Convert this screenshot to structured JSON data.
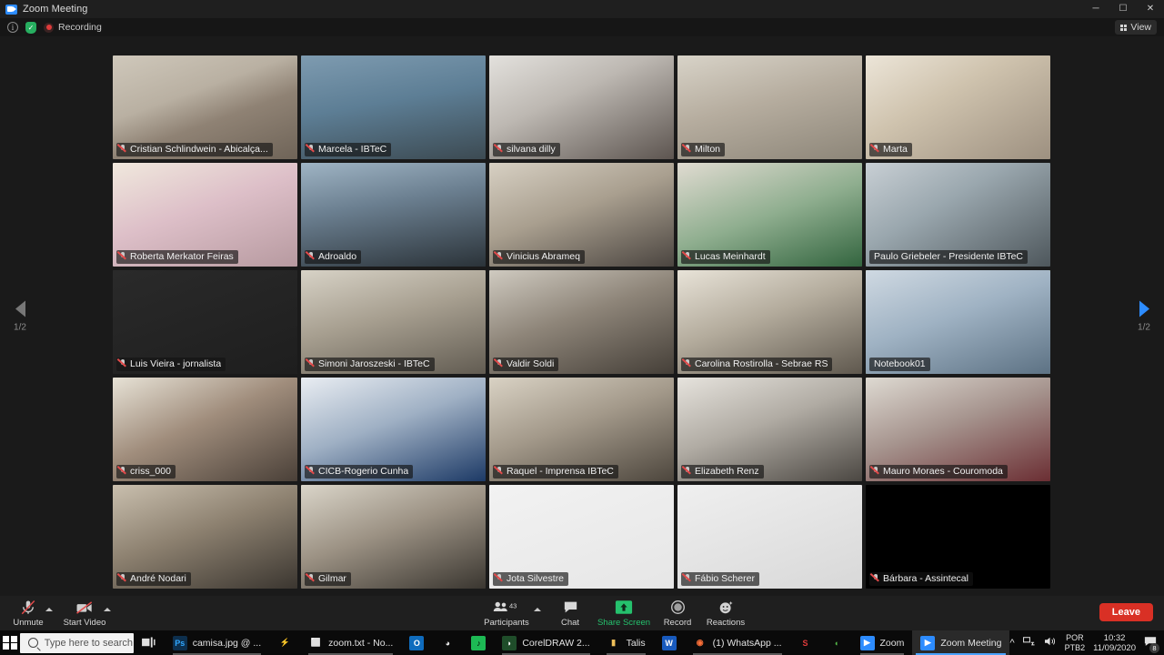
{
  "window": {
    "title": "Zoom Meeting",
    "logo_icon": "zoom-logo-icon",
    "minimize_label": "─",
    "maximize_label": "☐",
    "close_label": "✕"
  },
  "meeting_header": {
    "info_icon": "info-icon",
    "info_label": "i",
    "encryption_icon": "shield-check-icon",
    "encryption_label": "✓",
    "recording_icon": "recording-dot-icon",
    "recording_label": "Recording",
    "view_label": "View",
    "view_icon": "grid-view-icon"
  },
  "gallery": {
    "page_left_icon": "chevron-left-icon",
    "page_right_icon": "chevron-right-icon",
    "page_indicator_left": "1/2",
    "page_indicator_right": "1/2",
    "active_border_color": "#d6e040",
    "participants": [
      {
        "name": "Cristian Schlindwein - Abicalça...",
        "muted": true,
        "active": false,
        "bg": "linear-gradient(160deg,#cfc8bb 0%,#b9b0a2 38%,#8f8274 60%,#6f6458 100%)"
      },
      {
        "name": "Marcela - IBTeC",
        "muted": true,
        "active": false,
        "bg": "linear-gradient(170deg,#7e9bb0 0%,#5d7e95 45%,#3c4a52 100%)"
      },
      {
        "name": "silvana dilly",
        "muted": true,
        "active": false,
        "bg": "linear-gradient(155deg,#e3e1dd 0%,#bdb8b2 40%,#5d5550 100%)"
      },
      {
        "name": "Milton",
        "muted": true,
        "active": false,
        "bg": "linear-gradient(165deg,#d8d3c8 0%,#b6ad9f 45%,#8d8679 100%)"
      },
      {
        "name": "Marta",
        "muted": true,
        "active": false,
        "bg": "linear-gradient(150deg,#ece5d8 0%,#cfc3ae 40%,#9d9080 100%)"
      },
      {
        "name": "Roberta Merkator Feiras",
        "muted": true,
        "active": false,
        "bg": "linear-gradient(160deg,#f0e8dd 0%,#ddbfc8 45%,#b79aa0 100%)"
      },
      {
        "name": "Adroaldo",
        "muted": true,
        "active": false,
        "bg": "linear-gradient(170deg,#9fb4c4 0%,#6b7f90 40%,#2b3339 100%)"
      },
      {
        "name": "Vinicius Abrameq",
        "muted": true,
        "active": false,
        "bg": "linear-gradient(160deg,#d7d0c3 0%,#a99f8f 45%,#4b4540 100%)"
      },
      {
        "name": "Lucas Meinhardt",
        "muted": true,
        "active": false,
        "bg": "linear-gradient(160deg,#e0dbd1 0%,#8fae8f 50%,#33653f 100%)"
      },
      {
        "name": "Paulo Griebeler - Presidente IBTeC",
        "muted": false,
        "active": false,
        "bg": "linear-gradient(150deg,#c8cfd4 0%,#9aa7ae 40%,#4e575c 100%)"
      },
      {
        "name": "Luis Vieira - jornalista",
        "muted": true,
        "active": false,
        "bg": "linear-gradient(160deg,#2a2a2a 0%,#1e1e1e 100%)"
      },
      {
        "name": "Simoni Jaroszeski - IBTeC",
        "muted": true,
        "active": false,
        "bg": "linear-gradient(165deg,#d7d2c6 0%,#a79f90 45%,#625c52 100%)"
      },
      {
        "name": "Valdir Soldi",
        "muted": true,
        "active": false,
        "bg": "linear-gradient(160deg,#cfcac0 0%,#8e8579 45%,#453f38 100%)"
      },
      {
        "name": "Carolina Rostirolla - Sebrae RS",
        "muted": true,
        "active": false,
        "bg": "linear-gradient(160deg,#e8e3d8 0%,#b3ab9c 45%,#5f584e 100%)"
      },
      {
        "name": "Notebook01",
        "muted": false,
        "active": true,
        "bg": "linear-gradient(160deg,#cfd9e2 0%,#9fb2c3 45%,#5d7284 100%)"
      },
      {
        "name": "criss_000",
        "muted": true,
        "active": false,
        "bg": "linear-gradient(155deg,#e7e2d6 0%,#a08d7c 45%,#4a4038 100%)"
      },
      {
        "name": "CICB-Rogerio Cunha",
        "muted": true,
        "active": false,
        "bg": "linear-gradient(160deg,#e9edf2 0%,#9fb0c4 45%,#1d3a66 100%)"
      },
      {
        "name": "Raquel - Imprensa IBTeC",
        "muted": true,
        "active": false,
        "bg": "linear-gradient(160deg,#d9d2c4 0%,#a3998a 45%,#4d463d 100%)"
      },
      {
        "name": "Elizabeth Renz",
        "muted": true,
        "active": false,
        "bg": "linear-gradient(160deg,#e6e3dd 0%,#b0aba3 45%,#4b4742 100%)"
      },
      {
        "name": "Mauro Moraes - Couromoda",
        "muted": true,
        "active": false,
        "bg": "linear-gradient(160deg,#dedad2 0%,#a6948e 45%,#6b2e33 100%)"
      },
      {
        "name": "André Nodari",
        "muted": true,
        "active": false,
        "bg": "linear-gradient(160deg,#c9bfae 0%,#8d8170 45%,#3b3630 100%)"
      },
      {
        "name": "Gilmar",
        "muted": true,
        "active": false,
        "bg": "linear-gradient(160deg,#dad5c9 0%,#9c9284 45%,#3a3630 100%)"
      },
      {
        "name": "Jota Silvestre",
        "muted": true,
        "active": false,
        "bg": "linear-gradient(160deg,#f2f2f2 0%,#e6e6e6 100%)"
      },
      {
        "name": "Fábio Scherer",
        "muted": true,
        "active": false,
        "bg": "linear-gradient(160deg,#efefef 0%,#d8d8d8 100%)"
      },
      {
        "name": "Bárbara - Assintecal",
        "muted": true,
        "active": false,
        "bg": "#000000"
      }
    ]
  },
  "toolbar": {
    "mute_icon": "microphone-muted-icon",
    "mute_label": "Unmute",
    "mute_caret_icon": "chevron-up-icon",
    "video_icon": "camera-off-icon",
    "video_label": "Start Video",
    "video_caret_icon": "chevron-up-icon",
    "participants_icon": "participants-icon",
    "participants_label": "Participants",
    "participants_count": "43",
    "participants_caret_icon": "chevron-up-icon",
    "chat_icon": "chat-bubble-icon",
    "chat_label": "Chat",
    "share_icon": "share-screen-icon",
    "share_label": "Share Screen",
    "share_color": "#25c16d",
    "record_icon": "record-circle-icon",
    "record_label": "Record",
    "reactions_icon": "reactions-smiley-icon",
    "reactions_label": "Reactions",
    "leave_label": "Leave",
    "leave_color": "#d93025"
  },
  "taskbar": {
    "start_icon": "windows-start-icon",
    "search_icon": "search-icon",
    "search_placeholder": "Type here to search",
    "taskview_icon": "task-view-icon",
    "apps": [
      {
        "label": "camisa.jpg @ ...",
        "icon": "photoshop-icon",
        "glyph": "Ps",
        "color": "#0d2f4d",
        "text": "#31a8ff",
        "open": true,
        "active": false
      },
      {
        "label": "",
        "icon": "lightning-icon",
        "glyph": "⚡",
        "color": "transparent",
        "text": "#f0a030",
        "open": false,
        "active": false
      },
      {
        "label": "zoom.txt - No...",
        "icon": "notepad-icon",
        "glyph": "⬜",
        "color": "transparent",
        "text": "#cfe3f5",
        "open": true,
        "active": false
      },
      {
        "label": "",
        "icon": "outlook-icon",
        "glyph": "O",
        "color": "#0f6cbd",
        "text": "#ffffff",
        "open": false,
        "active": false
      },
      {
        "label": "",
        "icon": "clock-icon",
        "glyph": "◕",
        "color": "transparent",
        "text": "#e8e8e8",
        "open": false,
        "active": false
      },
      {
        "label": "",
        "icon": "spotify-icon",
        "glyph": "♪",
        "color": "#1db954",
        "text": "#000000",
        "open": false,
        "active": false
      },
      {
        "label": "CorelDRAW 2...",
        "icon": "coreldraw-icon",
        "glyph": "◗",
        "color": "#1f4d2a",
        "text": "#ffffff",
        "open": true,
        "active": false
      },
      {
        "label": "Talis",
        "icon": "folder-icon",
        "glyph": "▮",
        "color": "transparent",
        "text": "#f0c05a",
        "open": true,
        "active": false
      },
      {
        "label": "",
        "icon": "word-icon",
        "glyph": "W",
        "color": "#185abd",
        "text": "#ffffff",
        "open": false,
        "active": false
      },
      {
        "label": "(1) WhatsApp ...",
        "icon": "firefox-icon",
        "glyph": "◉",
        "color": "transparent",
        "text": "#ff7139",
        "open": true,
        "active": false
      },
      {
        "label": "",
        "icon": "s-app-icon",
        "glyph": "S",
        "color": "transparent",
        "text": "#e03b3b",
        "open": false,
        "active": false
      },
      {
        "label": "",
        "icon": "leaf-app-icon",
        "glyph": "◖",
        "color": "transparent",
        "text": "#54b848",
        "open": false,
        "active": false
      },
      {
        "label": "Zoom",
        "icon": "zoom-icon",
        "glyph": "▶",
        "color": "#2d8cff",
        "text": "#ffffff",
        "open": true,
        "active": false
      },
      {
        "label": "Zoom Meeting",
        "icon": "zoom-icon",
        "glyph": "▶",
        "color": "#2d8cff",
        "text": "#ffffff",
        "open": true,
        "active": true
      }
    ],
    "tray": {
      "overflow_icon": "chevron-up-icon",
      "network_icon": "network-icon",
      "volume_icon": "volume-icon",
      "lang_line1": "POR",
      "lang_line2": "PTB2",
      "time": "10:32",
      "date": "11/09/2020",
      "notifications_icon": "notifications-icon",
      "notifications_count": "8"
    }
  }
}
